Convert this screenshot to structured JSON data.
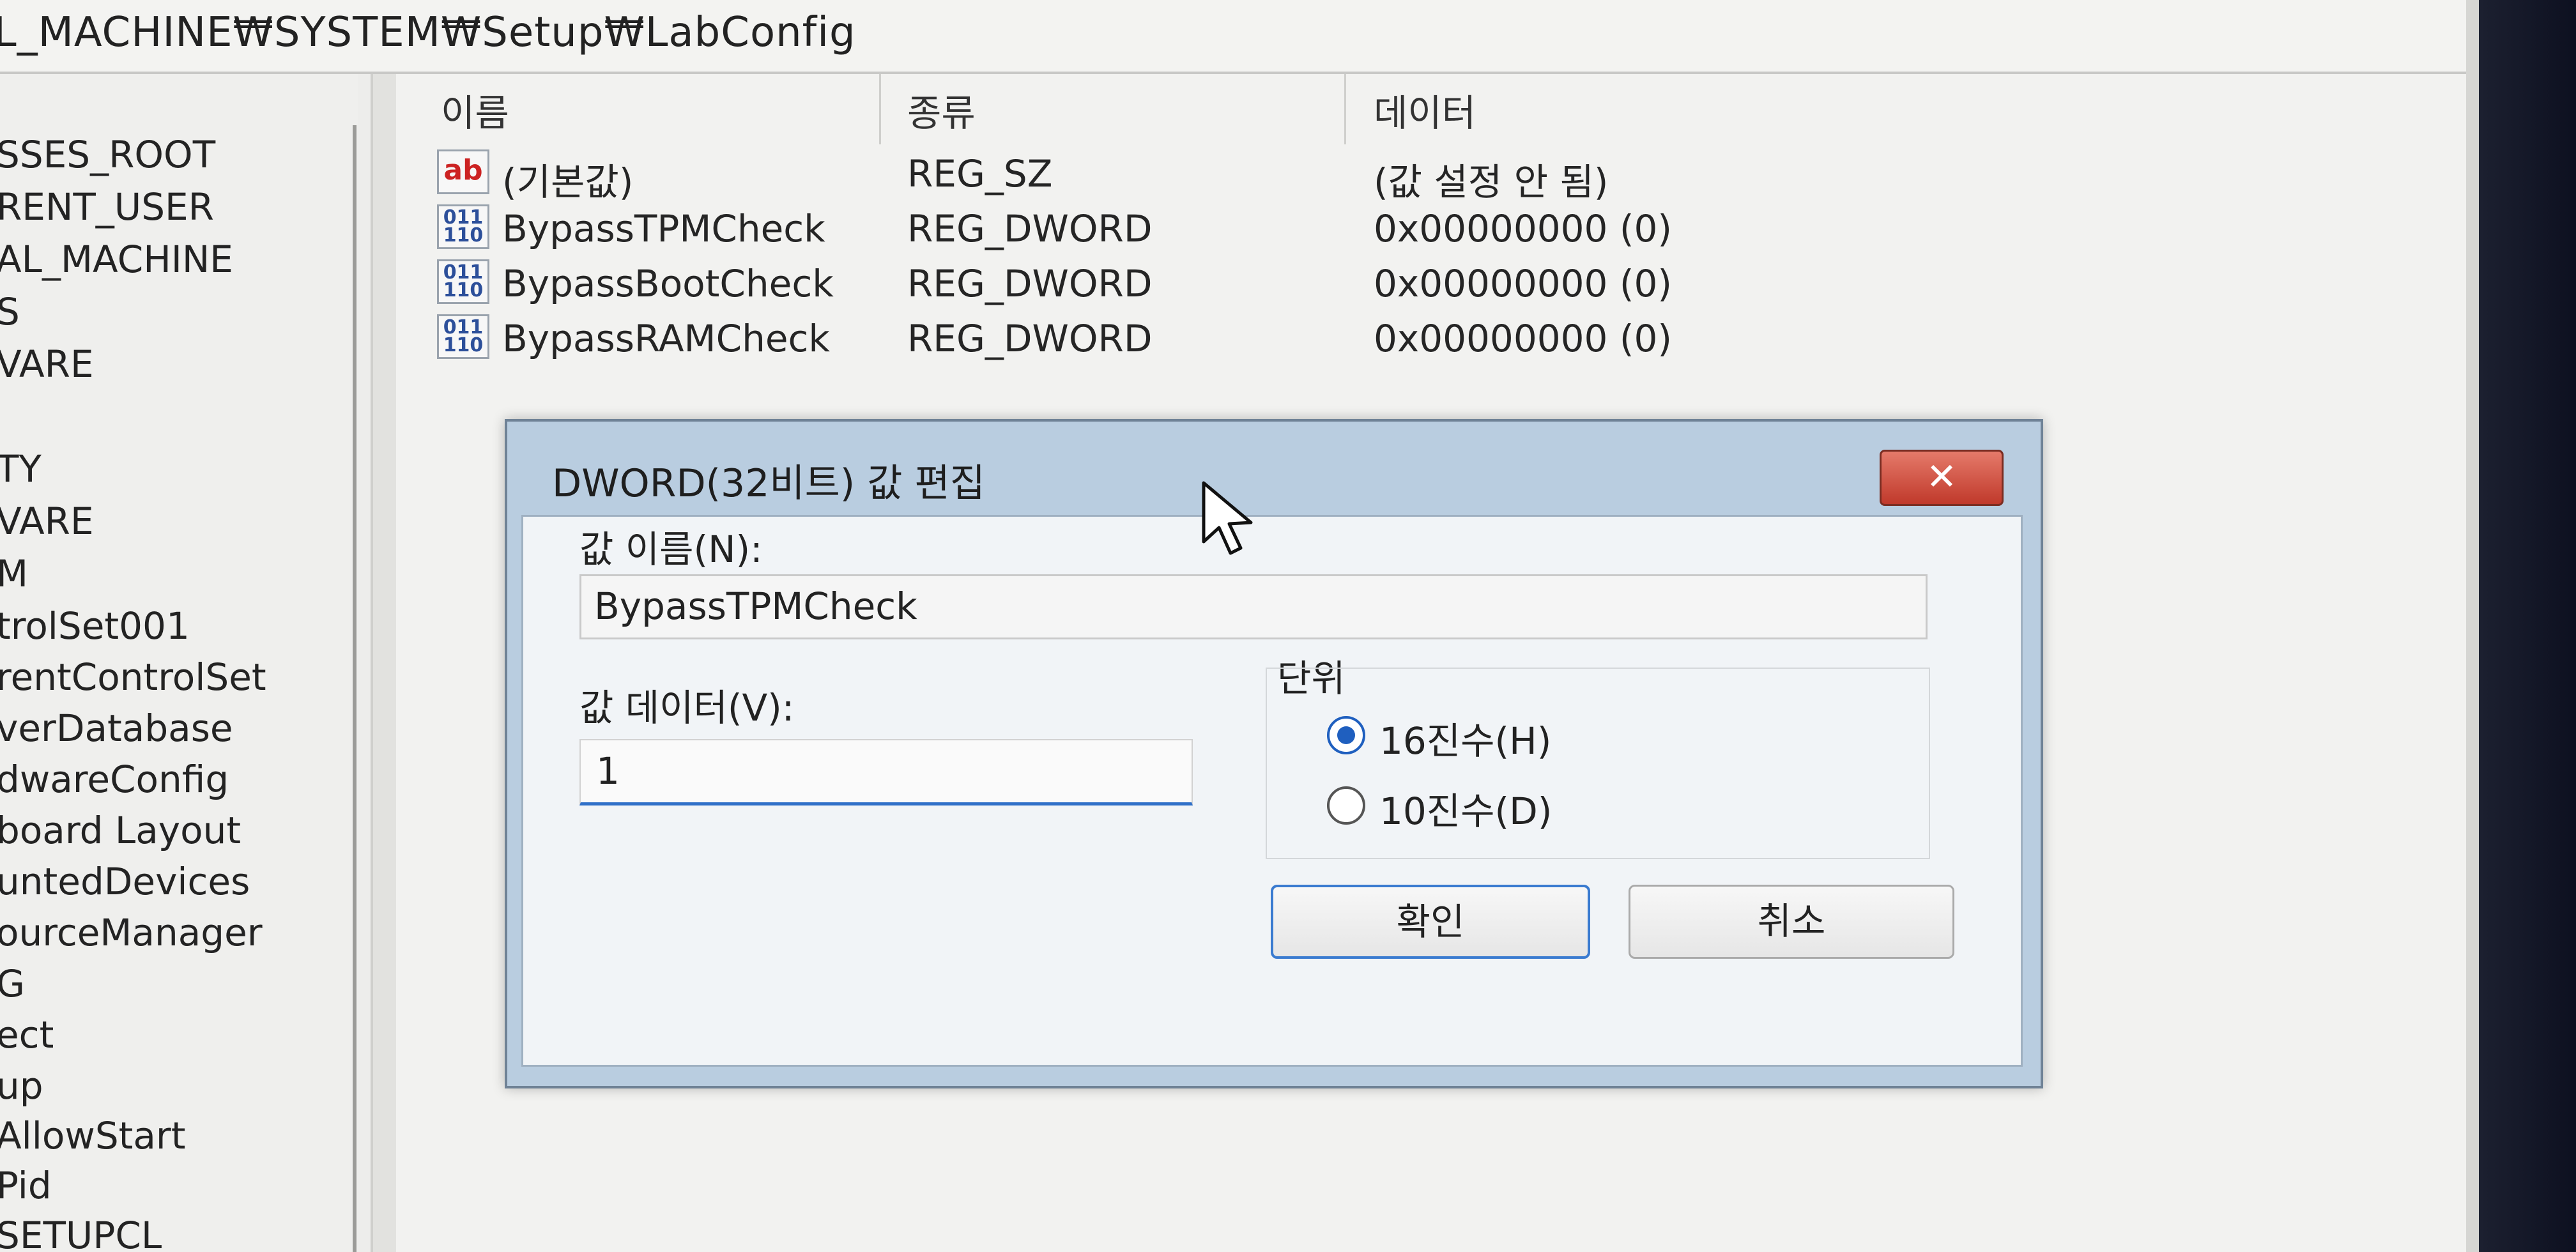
{
  "address_bar": {
    "path": "L_MACHINE₩SYSTEM₩Setup₩LabConfig"
  },
  "tree": {
    "items": [
      "SSES_ROOT",
      "RENT_USER",
      "AL_MACHINE",
      "S",
      "VARE",
      "TY",
      "VARE",
      "M",
      "trolSet001",
      "rentControlSet",
      "verDatabase",
      "dwareConfig",
      "board Layout",
      "untedDevices",
      "ourceManager",
      "G",
      "ect",
      "up",
      "AllowStart",
      "Pid",
      "SETUPCL"
    ]
  },
  "list": {
    "columns": {
      "name": "이름",
      "type": "종류",
      "data": "데이터"
    },
    "rows": [
      {
        "icon": "string-value-icon",
        "name": "(기본값)",
        "type": "REG_SZ",
        "data": "(값 설정 안 됨)"
      },
      {
        "icon": "binary-value-icon",
        "name": "BypassTPMCheck",
        "type": "REG_DWORD",
        "data": "0x00000000 (0)"
      },
      {
        "icon": "binary-value-icon",
        "name": "BypassBootCheck",
        "type": "REG_DWORD",
        "data": "0x00000000 (0)"
      },
      {
        "icon": "binary-value-icon",
        "name": "BypassRAMCheck",
        "type": "REG_DWORD",
        "data": "0x00000000 (0)"
      }
    ]
  },
  "dialog": {
    "title": "DWORD(32비트) 값 편집",
    "close_glyph": "✕",
    "value_name_label": "값 이름(N):",
    "value_name": "BypassTPMCheck",
    "value_data_label": "값 데이터(V):",
    "value_data": "1",
    "unit_label": "단위",
    "unit_options": [
      {
        "label": "16진수(H)",
        "selected": true
      },
      {
        "label": "10진수(D)",
        "selected": false
      }
    ],
    "ok_label": "확인",
    "cancel_label": "취소"
  },
  "icons": {
    "ab_glyph": "ab",
    "bin_glyph": "011\n110"
  },
  "colors": {
    "accent": "#2f6fc8",
    "dialog_frame": "#b9cde0",
    "close_button": "#c0392b"
  }
}
